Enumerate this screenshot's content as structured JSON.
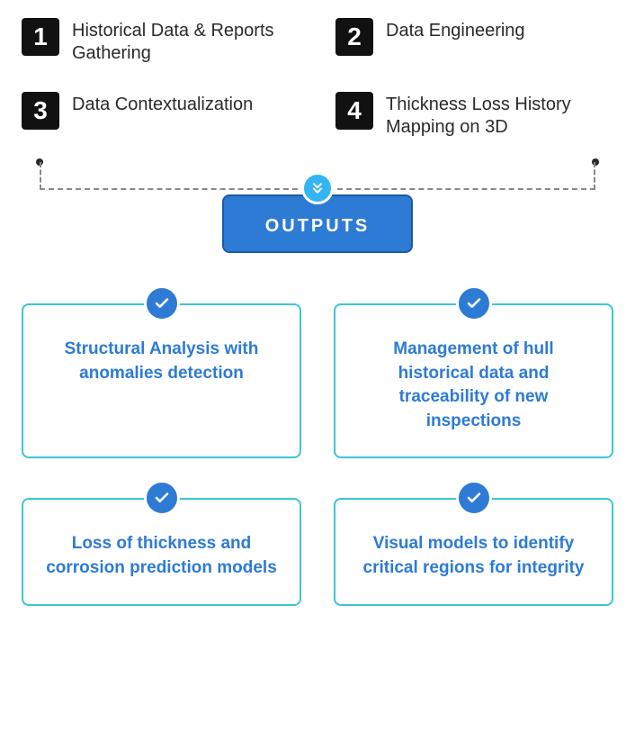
{
  "steps": [
    {
      "num": "1",
      "label": "Historical Data & Reports Gathering"
    },
    {
      "num": "2",
      "label": "Data Engineering"
    },
    {
      "num": "3",
      "label": "Data Contextualization"
    },
    {
      "num": "4",
      "label": "Thickness Loss History Mapping on 3D"
    }
  ],
  "outputs_heading": "OUTPUTS",
  "outputs": [
    "Structural Analysis with anomalies detection",
    "Management of hull historical data and traceability of new inspections",
    "Loss of thickness and corrosion prediction models",
    "Visual models to identify critical regions for integrity"
  ]
}
